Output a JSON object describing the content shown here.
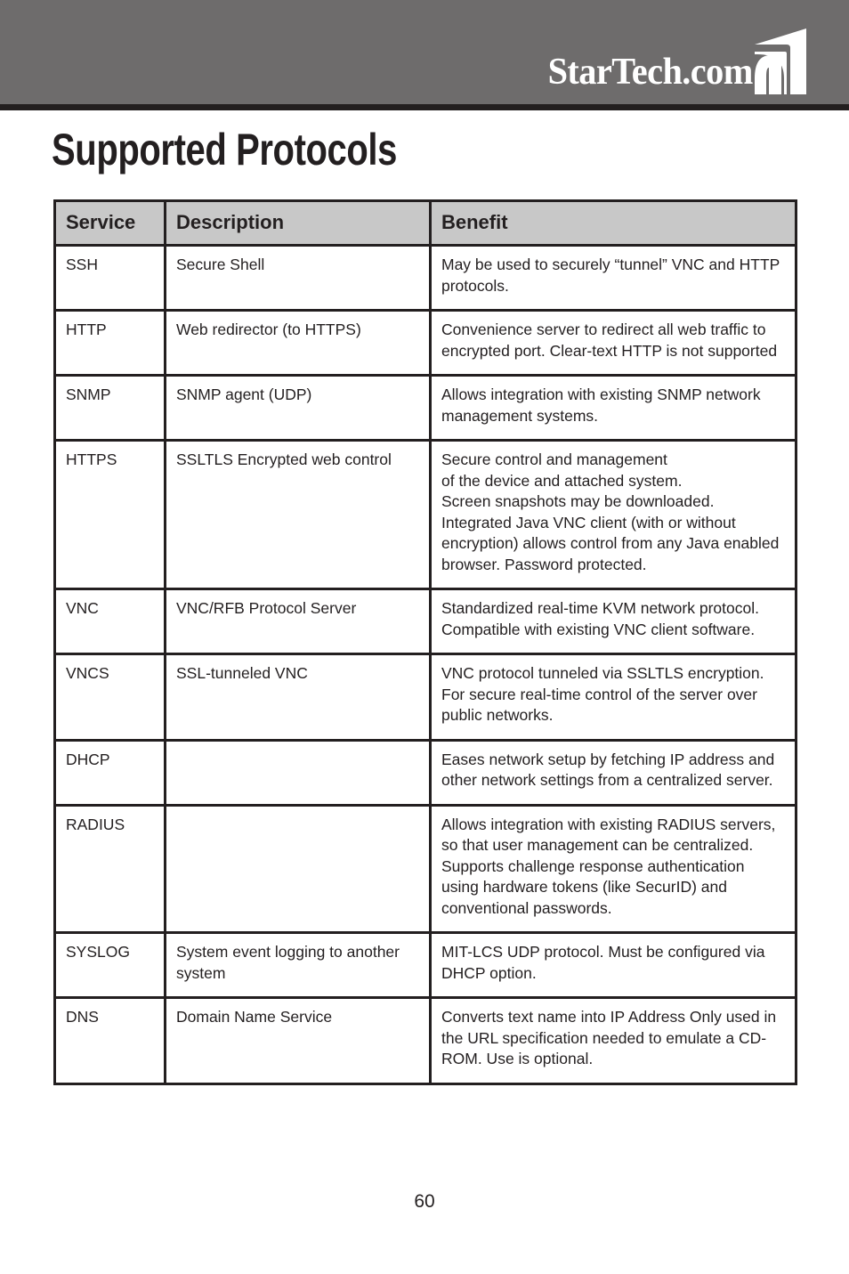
{
  "banner": {
    "logo_text": "StarTech.com",
    "logo_mark_name": "startech-swoosh-icon",
    "background_color": "#6e6c6c",
    "rule_color": "#231f1f"
  },
  "page_title": "Supported Protocols",
  "table": {
    "header_background": "#c8c8c8",
    "columns": [
      "Service",
      "Description",
      "Benefit"
    ],
    "rows": [
      {
        "service": "SSH",
        "description": "Secure Shell",
        "benefit": "May be used to securely “tunnel” VNC and HTTP protocols."
      },
      {
        "service": "HTTP",
        "description": "Web redirector (to HTTPS)",
        "benefit": "Convenience server to redirect all web traffic to encrypted port. Clear-text HTTP is not supported"
      },
      {
        "service": "SNMP",
        "description": "SNMP agent (UDP)",
        "benefit": "Allows integration with existing SNMP network management systems."
      },
      {
        "service": "HTTPS",
        "description": "SSLTLS Encrypted web control",
        "benefit": "Secure control and management\nof the device and attached system.\nScreen snapshots may be downloaded.\nIntegrated Java VNC client (with or without encryption) allows control from any Java enabled browser. Password protected."
      },
      {
        "service": "VNC",
        "description": "VNC/RFB Protocol Server",
        "benefit": "Standardized real-time KVM network protocol. Compatible with existing VNC client software."
      },
      {
        "service": "VNCS",
        "description": "SSL-tunneled VNC",
        "benefit": "VNC protocol tunneled via SSLTLS encryption. For secure real-time control of the server over public networks."
      },
      {
        "service": "DHCP",
        "description": "",
        "benefit": "Eases network setup by fetching IP address and other network settings from a centralized server."
      },
      {
        "service": "RADIUS",
        "description": "",
        "benefit": "Allows integration with existing RADIUS servers, so that user management can be centralized. Supports challenge response authentication using hardware tokens (like SecurID) and conventional passwords."
      },
      {
        "service": "SYSLOG",
        "description": "System event logging to another system",
        "benefit": "MIT-LCS UDP protocol. Must be configured via DHCP option."
      },
      {
        "service": "DNS",
        "description": "Domain Name Service",
        "benefit": "Converts text name into IP Address Only used in the URL specification needed to emulate a CD-ROM. Use is optional."
      }
    ]
  },
  "footer": {
    "page_number": "60"
  }
}
